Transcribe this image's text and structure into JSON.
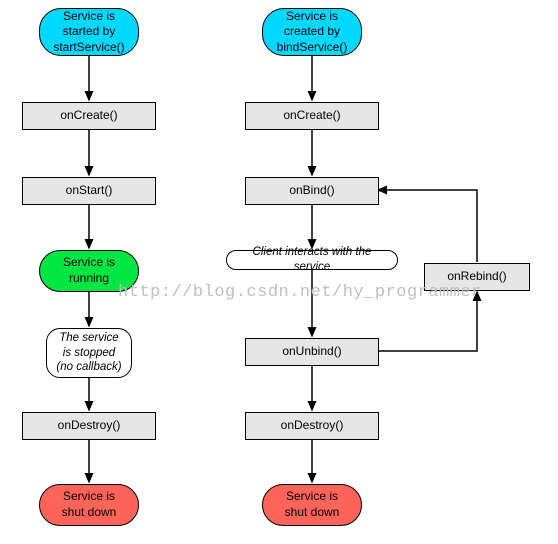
{
  "diagram": {
    "left": {
      "start": "Service is\nstarted by\nstartService()",
      "onCreate": "onCreate()",
      "onStart": "onStart()",
      "running": "Service is\nrunning",
      "stopped_note": "The service\nis stopped\n(no callback)",
      "onDestroy": "onDestroy()",
      "shutdown": "Service is\nshut down"
    },
    "right": {
      "start": "Service is\ncreated by\nbindService()",
      "onCreate": "onCreate()",
      "onBind": "onBind()",
      "client_note": "Client interacts with the service",
      "onRebind": "onRebind()",
      "onUnbind": "onUnbind()",
      "onDestroy": "onDestroy()",
      "shutdown": "Service is\nshut down"
    },
    "watermark": "http://blog.csdn.net/hy_programmer"
  },
  "colors": {
    "cyan": "#00d9ff",
    "green": "#00e642",
    "red": "#ff6459",
    "grey": "#e6e6e6"
  }
}
